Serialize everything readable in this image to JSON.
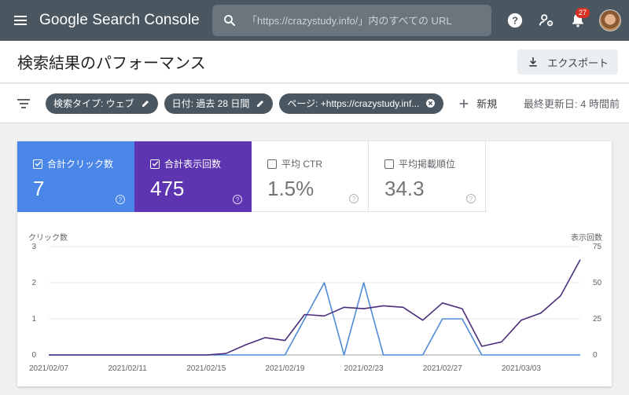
{
  "app": {
    "brand": "Google Search Console"
  },
  "search": {
    "placeholder": "「https://crazystudy.info/」内のすべての URL"
  },
  "notifications": {
    "count": "27"
  },
  "page": {
    "title": "検索結果のパフォーマンス",
    "export_label": "エクスポート"
  },
  "filters": {
    "chips": [
      {
        "label": "検索タイプ: ウェブ"
      },
      {
        "label": "日付: 過去 28 日間"
      },
      {
        "label": "ページ: +https://crazystudy.inf..."
      }
    ],
    "new_label": "新規",
    "updated": "最終更新日: 4 時間前"
  },
  "metrics": [
    {
      "label": "合計クリック数",
      "value": "7",
      "checked": true,
      "color": "#4a86e8"
    },
    {
      "label": "合計表示回数",
      "value": "475",
      "checked": true,
      "color": "#5e35b1"
    },
    {
      "label": "平均 CTR",
      "value": "1.5%",
      "checked": false
    },
    {
      "label": "平均掲載順位",
      "value": "34.3",
      "checked": false
    }
  ],
  "chart_data": {
    "type": "line",
    "y_left_label": "クリック数",
    "y_right_label": "表示回数",
    "y_left_ticks": [
      0,
      1,
      2,
      3
    ],
    "y_right_ticks": [
      0,
      25,
      50,
      75
    ],
    "ylim_left": [
      0,
      3
    ],
    "ylim_right": [
      0,
      75
    ],
    "x": [
      "2021/02/07",
      "2021/02/08",
      "2021/02/09",
      "2021/02/10",
      "2021/02/11",
      "2021/02/12",
      "2021/02/13",
      "2021/02/14",
      "2021/02/15",
      "2021/02/16",
      "2021/02/17",
      "2021/02/18",
      "2021/02/19",
      "2021/02/20",
      "2021/02/21",
      "2021/02/22",
      "2021/02/23",
      "2021/02/24",
      "2021/02/25",
      "2021/02/26",
      "2021/02/27",
      "2021/02/28",
      "2021/03/01",
      "2021/03/02",
      "2021/03/03",
      "2021/03/04",
      "2021/03/05",
      "2021/03/06"
    ],
    "x_tick_labels": [
      "2021/02/07",
      "2021/02/11",
      "2021/02/15",
      "2021/02/19",
      "2021/02/23",
      "2021/02/27",
      "2021/03/03"
    ],
    "series": [
      {
        "name": "クリック数",
        "axis": "left",
        "color": "#4e8cd6",
        "values": [
          0,
          0,
          0,
          0,
          0,
          0,
          0,
          0,
          0,
          0,
          0,
          0,
          0,
          1,
          2,
          0,
          2,
          0,
          0,
          0,
          1,
          1,
          0,
          0,
          0,
          0,
          0,
          0
        ]
      },
      {
        "name": "表示回数",
        "axis": "right",
        "color": "#4a2e7a",
        "values": [
          0,
          0,
          0,
          0,
          0,
          0,
          0,
          0,
          0,
          1,
          7,
          12,
          10,
          28,
          27,
          33,
          32,
          34,
          33,
          24,
          36,
          32,
          6,
          9,
          24,
          29,
          41,
          66
        ]
      }
    ],
    "grid": true
  }
}
